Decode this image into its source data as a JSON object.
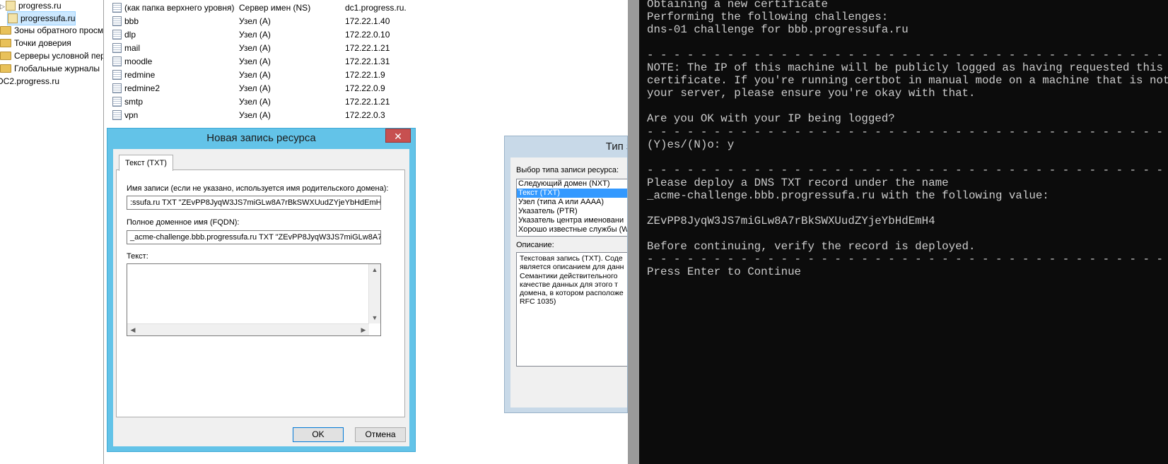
{
  "tree": {
    "items": [
      {
        "label": "progress.ru",
        "kind": "zone",
        "expander": "▷"
      },
      {
        "label": "progressufa.ru",
        "kind": "zone",
        "selected": true
      },
      {
        "label": "Зоны обратного просм",
        "kind": "folder"
      },
      {
        "label": "Точки доверия",
        "kind": "folder"
      },
      {
        "label": "Серверы условной пере",
        "kind": "folder"
      },
      {
        "label": "Глобальные журналы",
        "kind": "folder"
      },
      {
        "label": "DC2.progress.ru",
        "kind": "server"
      }
    ]
  },
  "records": [
    {
      "name": "(как папка верхнего уровня)",
      "type": "Сервер имен (NS)",
      "data": "dc1.progress.ru."
    },
    {
      "name": "bbb",
      "type": "Узел (A)",
      "data": "172.22.1.40"
    },
    {
      "name": "dlp",
      "type": "Узел (A)",
      "data": "172.22.0.10"
    },
    {
      "name": "mail",
      "type": "Узел (A)",
      "data": "172.22.1.21"
    },
    {
      "name": "moodle",
      "type": "Узел (A)",
      "data": "172.22.1.31"
    },
    {
      "name": "redmine",
      "type": "Узел (A)",
      "data": "172.22.1.9"
    },
    {
      "name": "redmine2",
      "type": "Узел (A)",
      "data": "172.22.0.9"
    },
    {
      "name": "smtp",
      "type": "Узел (A)",
      "data": "172.22.1.21"
    },
    {
      "name": "vpn",
      "type": "Узел (A)",
      "data": "172.22.0.3"
    }
  ],
  "dialog": {
    "title": "Новая запись ресурса",
    "close": "✕",
    "tab": "Текст (TXT)",
    "name_label": "Имя записи (если не указано, используется имя родительского домена):",
    "name_value": ":ssufa.ru  TXT   \"ZEvPP8JyqW3JS7miGLw8A7rBkSWXUudZYjeYbHdEmH4\"",
    "name_selected": "60",
    "fqdn_label": "Полное доменное имя (FQDN):",
    "fqdn_value": "_acme-challenge.bbb.progressufa.ru  TXT   \"ZEvPP8JyqW3JS7miGLw8A7rBkS",
    "text_label": "Текст:",
    "ok": "OK",
    "cancel": "Отмена"
  },
  "type_dialog": {
    "title": "Тип за",
    "list_label": "Выбор типа записи ресурса:",
    "items": [
      {
        "label": "Следующий домен (NXT)"
      },
      {
        "label": "Текст (TXT)",
        "selected": true
      },
      {
        "label": "Узел (типа A или AAAA)"
      },
      {
        "label": "Указатель (PTR)"
      },
      {
        "label": "Указатель центра именовани"
      },
      {
        "label": "Хорошо известные службы (W"
      }
    ],
    "desc_label": "Описание:",
    "desc_lines": [
      "Текстовая запись (TXT). Соде",
      "является описанием для данн",
      "Семантики действительного",
      "качестве данных для этого т",
      "домена, в котором расположе",
      "RFC 1035)"
    ]
  },
  "terminal": {
    "lines": [
      "Obtaining a new certificate",
      "Performing the following challenges:",
      "dns-01 challenge for bbb.progressufa.ru",
      "",
      "- - - - - - - - - - - - - - - - - - - - - - - - - - - - - - - - - - - - - - - -",
      "NOTE: The IP of this machine will be publicly logged as having requested this",
      "certificate. If you're running certbot in manual mode on a machine that is not",
      "your server, please ensure you're okay with that.",
      "",
      "Are you OK with your IP being logged?",
      "- - - - - - - - - - - - - - - - - - - - - - - - - - - - - - - - - - - - - - - -",
      "(Y)es/(N)o: y",
      "",
      "- - - - - - - - - - - - - - - - - - - - - - - - - - - - - - - - - - - - - - - -",
      "Please deploy a DNS TXT record under the name",
      "_acme-challenge.bbb.progressufa.ru with the following value:",
      "",
      "ZEvPP8JyqW3JS7miGLw8A7rBkSWXUudZYjeYbHdEmH4",
      "",
      "Before continuing, verify the record is deployed.",
      "- - - - - - - - - - - - - - - - - - - - - - - - - - - - - - - - - - - - - - - -",
      "Press Enter to Continue"
    ]
  },
  "colors": {
    "dialog_frame": "#63c3e8",
    "selection": "#3399ff",
    "terminal_bg": "#0c0c0c",
    "terminal_fg": "#cccccc"
  }
}
